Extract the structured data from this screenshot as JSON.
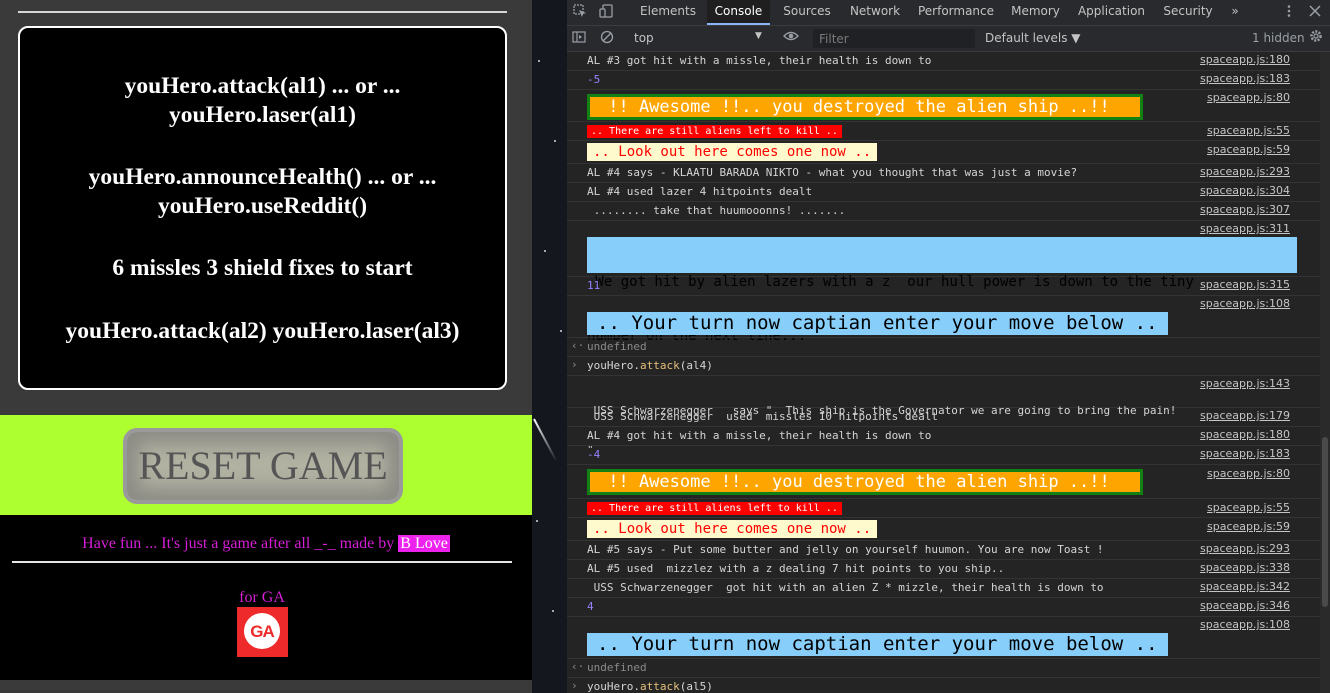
{
  "game": {
    "instructions": [
      "youHero.attack(al1) ... or ...",
      "youHero.laser(al1)",
      "youHero.announceHealth() ... or ...",
      "youHero.useReddit()",
      "6 missles 3 shield fixes to start",
      "youHero.attack(al2) youHero.laser(al3)"
    ],
    "reset_label": "RESET GAME",
    "footer_text": "Have fun ... It's just a game after all _-_ made by ",
    "author": "B Love",
    "for_ga": "for GA",
    "logo_text": "GA",
    "colors": {
      "band": "#adff2f",
      "footer_magenta": "#d61ed6"
    }
  },
  "devtools": {
    "tabs": [
      "Elements",
      "Console",
      "Sources",
      "Network",
      "Performance",
      "Memory",
      "Application",
      "Security"
    ],
    "active_tab": "Console",
    "more_tabs": "»",
    "context": "top",
    "filter_placeholder": "Filter",
    "levels": "Default levels ▼",
    "hidden": "1 hidden",
    "icons": [
      "inspect-icon",
      "device-icon",
      "kebab-icon",
      "close-icon",
      "sidebar-icon",
      "clear-icon",
      "eye-icon",
      "gear-icon"
    ]
  },
  "console": {
    "r1": {
      "text": "AL #3 got hit with a missle, their health is down to",
      "src": "spaceapp.js:180"
    },
    "r2": {
      "text": "-5",
      "src": "spaceapp.js:183"
    },
    "r3": {
      "text": " !! Awesome !!.. you destroyed the alien ship ..!!",
      "src": "spaceapp.js:80"
    },
    "r4": {
      "text": ".. There are still aliens left to kill ..",
      "src": "spaceapp.js:55"
    },
    "r5": {
      "text": ".. Look out here comes one now ..",
      "src": "spaceapp.js:59"
    },
    "r6": {
      "text": "AL #4 says - KLAATU BARADA NIKTO - what you thought that was just a movie?",
      "src": "spaceapp.js:293"
    },
    "r7": {
      "text": "AL #4 used lazer 4 hitpoints dealt",
      "src": "spaceapp.js:304"
    },
    "r8": {
      "text": " ........ take that huumooonns! .......",
      "src": "spaceapp.js:307"
    },
    "r9": {
      "text_a": " We got hit by alien lazers with a z  our hull power is down to the tiny",
      "text_b": "number on the next line...",
      "src": "spaceapp.js:311"
    },
    "r10": {
      "text": "11",
      "src": "spaceapp.js:315"
    },
    "r11": {
      "text": ".. Your turn now captian enter your move below ..",
      "src": "spaceapp.js:108"
    },
    "r12": {
      "text": "undefined"
    },
    "r13": {
      "pre": "youHero.",
      "fn": "attack",
      "post": "(al4)"
    },
    "r14": {
      "text_a": " USS Schwarzenegger   says \"  This ship is the Governator we are going to bring the pain!",
      "text_b": "\"",
      "src": "spaceapp.js:143"
    },
    "r15": {
      "text": " USS Schwarzenegger  used  missles 10 hitpoints dealt",
      "src": "spaceapp.js:179"
    },
    "r16": {
      "text": "AL #4 got hit with a missle, their health is down to",
      "src": "spaceapp.js:180"
    },
    "r17": {
      "text": "-4",
      "src": "spaceapp.js:183"
    },
    "r18": {
      "text": " !! Awesome !!.. you destroyed the alien ship ..!!",
      "src": "spaceapp.js:80"
    },
    "r19": {
      "text": ".. There are still aliens left to kill ..",
      "src": "spaceapp.js:55"
    },
    "r20": {
      "text": ".. Look out here comes one now ..",
      "src": "spaceapp.js:59"
    },
    "r21": {
      "text": "AL #5 says - Put some butter and jelly on yourself huumon. You are now Toast !",
      "src": "spaceapp.js:293"
    },
    "r22": {
      "text": "AL #5 used  mizzlez with a z dealing 7 hit points to you ship..",
      "src": "spaceapp.js:338"
    },
    "r23": {
      "text": " USS Schwarzenegger  got hit with an alien Z * mizzle, their health is down to",
      "src": "spaceapp.js:342"
    },
    "r24": {
      "text": "4",
      "src": "spaceapp.js:346"
    },
    "r25": {
      "text": ".. Your turn now captian enter your move below ..",
      "src": "spaceapp.js:108"
    },
    "r26": {
      "text": "undefined"
    },
    "r27": {
      "pre": "youHero.",
      "fn": "attack",
      "post": "(al5)"
    },
    "arrow_out": "‹·",
    "arrow_in": "›"
  }
}
